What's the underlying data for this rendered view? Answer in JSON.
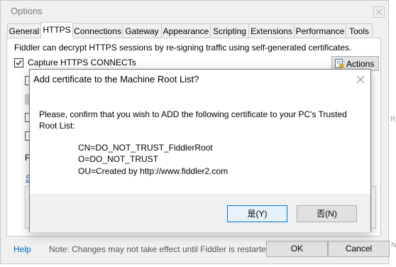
{
  "options": {
    "title": "Options",
    "tabs": [
      {
        "label": "General"
      },
      {
        "label": "HTTPS"
      },
      {
        "label": "Connections"
      },
      {
        "label": "Gateway"
      },
      {
        "label": "Appearance"
      },
      {
        "label": "Scripting"
      },
      {
        "label": "Extensions"
      },
      {
        "label": "Performance"
      },
      {
        "label": "Tools"
      }
    ],
    "active_tab": "HTTPS",
    "description": "Fiddler can decrypt HTTPS sessions by re-signing traffic using self-generated certificates.",
    "capture_label": "Capture HTTPS CONNECTs",
    "capture_checked": true,
    "actions_label": "Actions",
    "fragment_p": "P",
    "fragment_link": "S",
    "help_label": "Help",
    "note": "Note: Changes may not take effect until Fiddler is restarted.",
    "ok_label": "OK",
    "cancel_label": "Cancel"
  },
  "dialog": {
    "title": "Add certificate to the Machine Root List?",
    "message": "Please, confirm that you wish to ADD the following certificate to your PC's Trusted Root List:",
    "cert_cn": "CN=DO_NOT_TRUST_FiddlerRoot",
    "cert_o": "O=DO_NOT_TRUST",
    "cert_ou": "OU=Created by http://www.fiddler2.com",
    "yes_label": "是(Y)",
    "no_label": "否(N)"
  },
  "edge_fragments": {
    "a": "R",
    "b": "N"
  },
  "colors": {
    "accent": "#0078d7",
    "link": "#0066cc"
  }
}
